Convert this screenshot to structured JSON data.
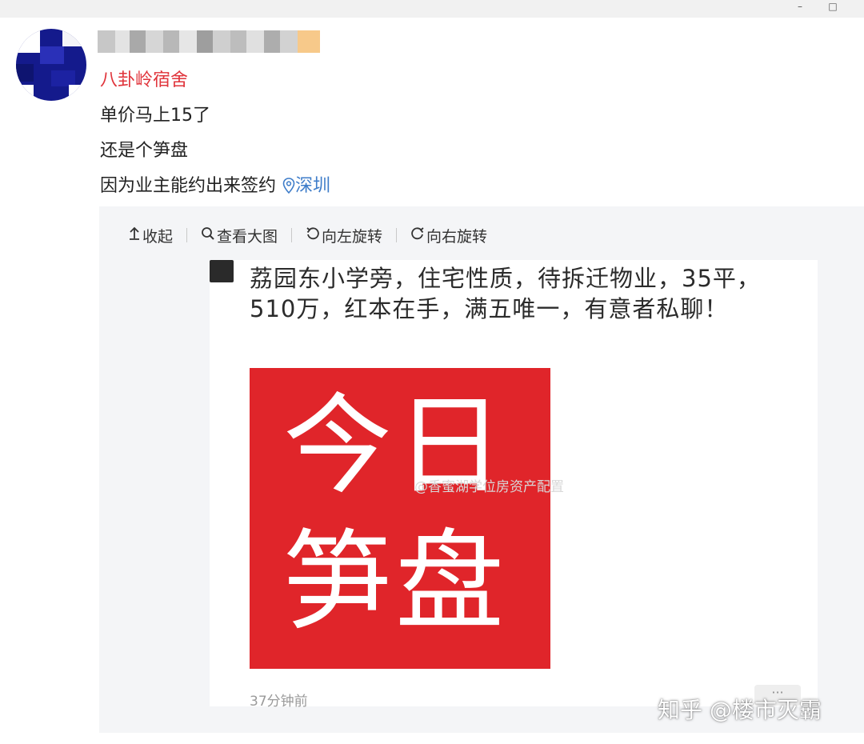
{
  "window": {
    "minimize_icon": "minimize-icon",
    "maximize_icon": "maximize-icon",
    "minimize_glyph": "–",
    "maximize_glyph": "□"
  },
  "post": {
    "group_name": "八卦岭宿舍",
    "lines": [
      "单价马上15了",
      "还是个笋盘",
      "因为业主能约出来签约"
    ],
    "location": "深圳",
    "colors": {
      "group": "#e0343b",
      "location": "#3d7cc9"
    }
  },
  "toolbar": {
    "collapse": "收起",
    "view_large": "查看大图",
    "rotate_left": "向左旋转",
    "rotate_right": "向右旋转"
  },
  "image_card": {
    "text": "荔园东小学旁，住宅性质，待拆迁物业，35平，510万，红本在手，满五唯一，有意者私聊！",
    "banner_line1": "今日",
    "banner_line2": "笋盘",
    "banner_color": "#e0252a",
    "watermark": "@香蜜湖学位房资产配置",
    "timestamp": "37分钟前",
    "more": "···"
  },
  "attribution": "知乎 @楼市灭霸"
}
